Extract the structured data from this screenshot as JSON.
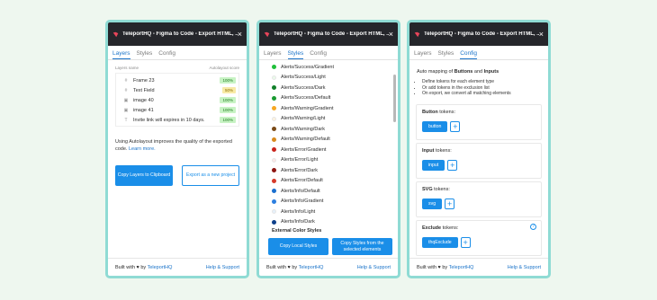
{
  "colors": {
    "accent": "#1a8ee8",
    "titlebar": "#25262b",
    "panel_border": "#8fdbd4",
    "background": "#eef7ef"
  },
  "window_title": "TeleportHQ - Figma to Code - Export HTML, ...",
  "tabs": [
    "Layers",
    "Styles",
    "Config"
  ],
  "footer": {
    "built_with": "Built with",
    "by": "by",
    "brand": "TeleportHQ",
    "help": "Help & Support"
  },
  "layers_panel": {
    "header_left": "Layers name",
    "header_right": "Autolayout score",
    "rows": [
      {
        "icon": "frame-icon",
        "name": "Frame 23",
        "score": "100%",
        "level": "green"
      },
      {
        "icon": "frame-icon",
        "name": "Text Field",
        "score": "50%",
        "level": "yellow"
      },
      {
        "icon": "image-icon",
        "name": "image 40",
        "score": "100%",
        "level": "green"
      },
      {
        "icon": "image-icon",
        "name": "image 41",
        "score": "100%",
        "level": "green"
      },
      {
        "icon": "text-icon",
        "name": "Invite link will expires in 10 days.",
        "score": "100%",
        "level": "green"
      }
    ],
    "note": "Using Autolayout improves the quality of the exported code.",
    "learn_more": "Learn more.",
    "copy_button": "Copy Layers to Clipboard",
    "export_button": "Export as a new project"
  },
  "styles_panel": {
    "items": [
      {
        "name": "Alerts/Success/Gradient",
        "color": "#1fbf3a"
      },
      {
        "name": "Alerts/Success/Light",
        "color": "#eafbea"
      },
      {
        "name": "Alerts/Success/Dark",
        "color": "#11802a"
      },
      {
        "name": "Alerts/Success/Default",
        "color": "#1a9a32"
      },
      {
        "name": "Alerts/Warning/Gradient",
        "color": "#f6a723"
      },
      {
        "name": "Alerts/Warning/Light",
        "color": "#fdf2e0"
      },
      {
        "name": "Alerts/Warning/Dark",
        "color": "#7a4a17"
      },
      {
        "name": "Alerts/Warning/Default",
        "color": "#d98a1c"
      },
      {
        "name": "Alerts/Error/Gradient",
        "color": "#c9231c"
      },
      {
        "name": "Alerts/Error/Light",
        "color": "#fbe7e6"
      },
      {
        "name": "Alerts/Error/Dark",
        "color": "#8d1511"
      },
      {
        "name": "Alerts/Error/Default",
        "color": "#d63a2a"
      },
      {
        "name": "Alerts/Info/Default",
        "color": "#1a6fcf"
      },
      {
        "name": "Alerts/Info/Gradient",
        "color": "#2d7fe0"
      },
      {
        "name": "Alerts/Info/Light",
        "color": "#e6f0fb"
      },
      {
        "name": "Alerts/Info/Dark",
        "color": "#0d3f8a"
      }
    ],
    "external_header": "External Color Styles",
    "copy_local_button": "Copy Local Styles",
    "copy_selected_button": "Copy Styles from the selected elements"
  },
  "config_panel": {
    "intro_prefix": "Auto mapping of",
    "intro_buttons": "Buttons",
    "intro_and": "and",
    "intro_inputs": "Inputs",
    "bullets": [
      "Define tokens for each element type",
      "Or add tokens in the exclusion list",
      "On export, we convert all matching elements"
    ],
    "token_suffix": "tokens:",
    "groups": [
      {
        "label": "Button",
        "chip": "button"
      },
      {
        "label": "Input",
        "chip": "input"
      },
      {
        "label": "SVG",
        "chip": "svg"
      },
      {
        "label": "Exclude",
        "chip": "thqExclude"
      }
    ],
    "help_glyph": "?"
  }
}
